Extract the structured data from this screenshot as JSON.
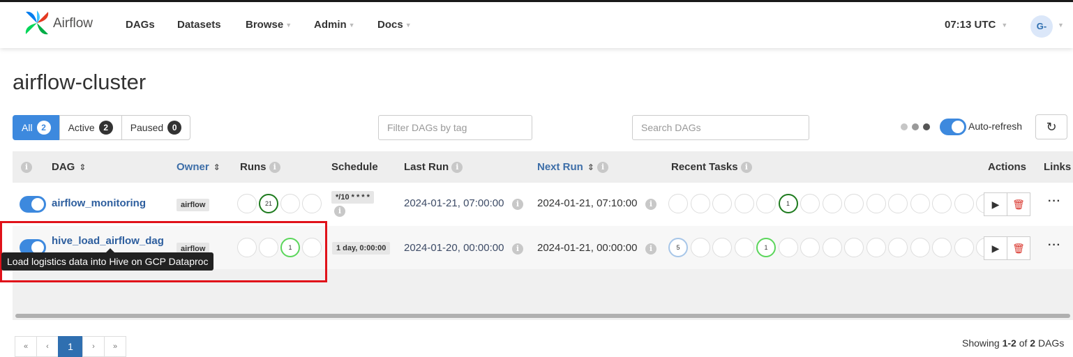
{
  "colors": {
    "accent": "#3d89de",
    "link": "#2d5e9e",
    "highlight_box": "#e0121a",
    "success_dark": "#1e7b1e",
    "success_light": "#5bd65b"
  },
  "navbar": {
    "brand": "Airflow",
    "items": [
      {
        "label": "DAGs",
        "dropdown": false
      },
      {
        "label": "Datasets",
        "dropdown": false
      },
      {
        "label": "Browse",
        "dropdown": true
      },
      {
        "label": "Admin",
        "dropdown": true
      },
      {
        "label": "Docs",
        "dropdown": true
      }
    ],
    "time": "07:13 UTC",
    "user_initials": "G-"
  },
  "page": {
    "title": "airflow-cluster"
  },
  "filters": {
    "all_label": "All",
    "all_count": "2",
    "active_label": "Active",
    "active_count": "2",
    "paused_label": "Paused",
    "paused_count": "0",
    "tag_placeholder": "Filter DAGs by tag",
    "search_placeholder": "Search DAGs",
    "autorefresh_label": "Auto-refresh",
    "autorefresh_on": true
  },
  "table": {
    "headers": {
      "dag": "DAG",
      "owner": "Owner",
      "runs": "Runs",
      "schedule": "Schedule",
      "last_run": "Last Run",
      "next_run": "Next Run",
      "recent_tasks": "Recent Tasks",
      "actions": "Actions",
      "links": "Links"
    },
    "rows": [
      {
        "dag_id": "airflow_monitoring",
        "owner": "airflow",
        "runs": [
          "",
          "21",
          "",
          ""
        ],
        "schedule_line1": "*/10 * * * *",
        "last_run": "2024-01-21, 07:00:00",
        "next_run": "2024-01-21, 07:10:00",
        "recent_tasks": [
          "",
          "",
          "",
          "",
          "",
          "1",
          "",
          "",
          "",
          "",
          "",
          "",
          "",
          "",
          ""
        ],
        "active": true
      },
      {
        "dag_id": "hive_load_airflow_dag",
        "owner": "airflow",
        "runs": [
          "",
          "",
          "1",
          ""
        ],
        "schedule": "1 day, 0:00:00",
        "last_run": "2024-01-20, 00:00:00",
        "next_run": "2024-01-21, 00:00:00",
        "recent_tasks": [
          "5",
          "",
          "",
          "",
          "1",
          "",
          "",
          "",
          "",
          "",
          "",
          "",
          "",
          "",
          ""
        ],
        "active": true
      }
    ]
  },
  "tooltip": {
    "text": "Load logistics data into Hive on GCP Dataproc"
  },
  "pagination": {
    "first": "«",
    "prev": "‹",
    "current": "1",
    "next": "›",
    "last": "»",
    "showing_prefix": "Showing ",
    "showing_range": "1-2",
    "showing_mid": " of ",
    "showing_total": "2",
    "showing_suffix": " DAGs"
  }
}
